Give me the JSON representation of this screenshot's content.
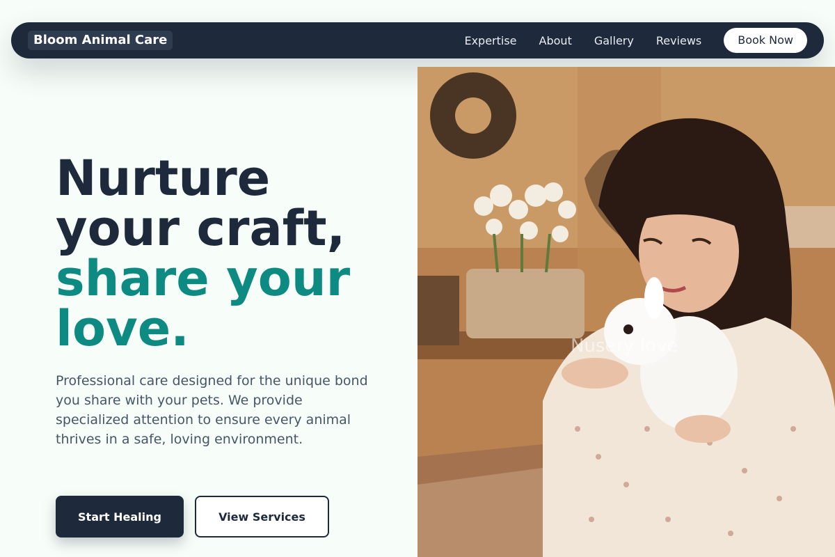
{
  "nav": {
    "logo": "Bloom Animal Care",
    "links": [
      "Expertise",
      "About",
      "Gallery",
      "Reviews"
    ],
    "cta": "Book Now"
  },
  "hero": {
    "title_line1": "Nurture",
    "title_line2": "your craft,",
    "title_line3": "share your",
    "title_line4": "love.",
    "description": "Professional care designed for the unique bond you share with your pets. We provide specialized attention to ensure every animal thrives in a safe, loving environment.",
    "primary_button": "Start Healing",
    "secondary_button": "View Services",
    "image_overlay_text": "Nusery love"
  },
  "colors": {
    "navy": "#1e293b",
    "teal_accent": "#0d8b82",
    "background": "#f7fdf8",
    "body_text": "#475569"
  }
}
